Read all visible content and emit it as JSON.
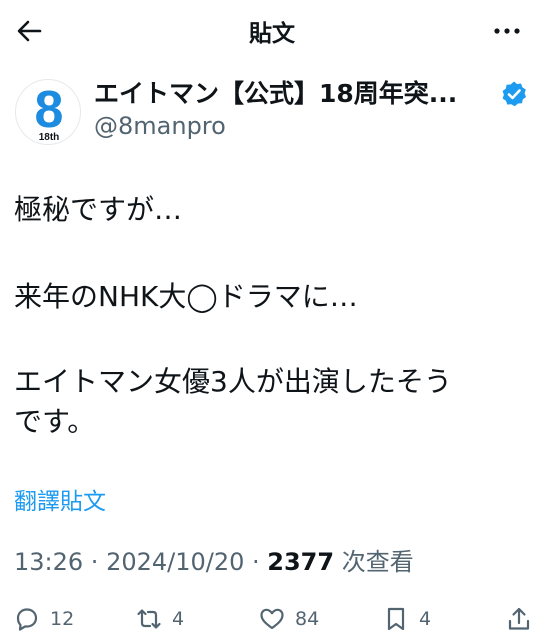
{
  "header": {
    "title": "貼文"
  },
  "author": {
    "avatar_text": "8",
    "avatar_sub": "18th",
    "name": "エイトマン【公式】18周年突...",
    "handle": "@8manpro"
  },
  "post": {
    "lines": [
      "極秘ですが…",
      "来年のNHK大◯ドラマに…",
      "エイトマン女優3人が出演したそう",
      "です。"
    ]
  },
  "translate_label": "翻譯貼文",
  "meta": {
    "time": "13:26",
    "sep1": " · ",
    "date": "2024/10/20",
    "sep2": " · ",
    "views": "2377",
    "views_label": " 次查看"
  },
  "actions": {
    "replies": "12",
    "reposts": "4",
    "likes": "84",
    "bookmarks": "4"
  },
  "colors": {
    "accent": "#1d9bf0",
    "text": "#0f1419",
    "muted": "#536471"
  }
}
